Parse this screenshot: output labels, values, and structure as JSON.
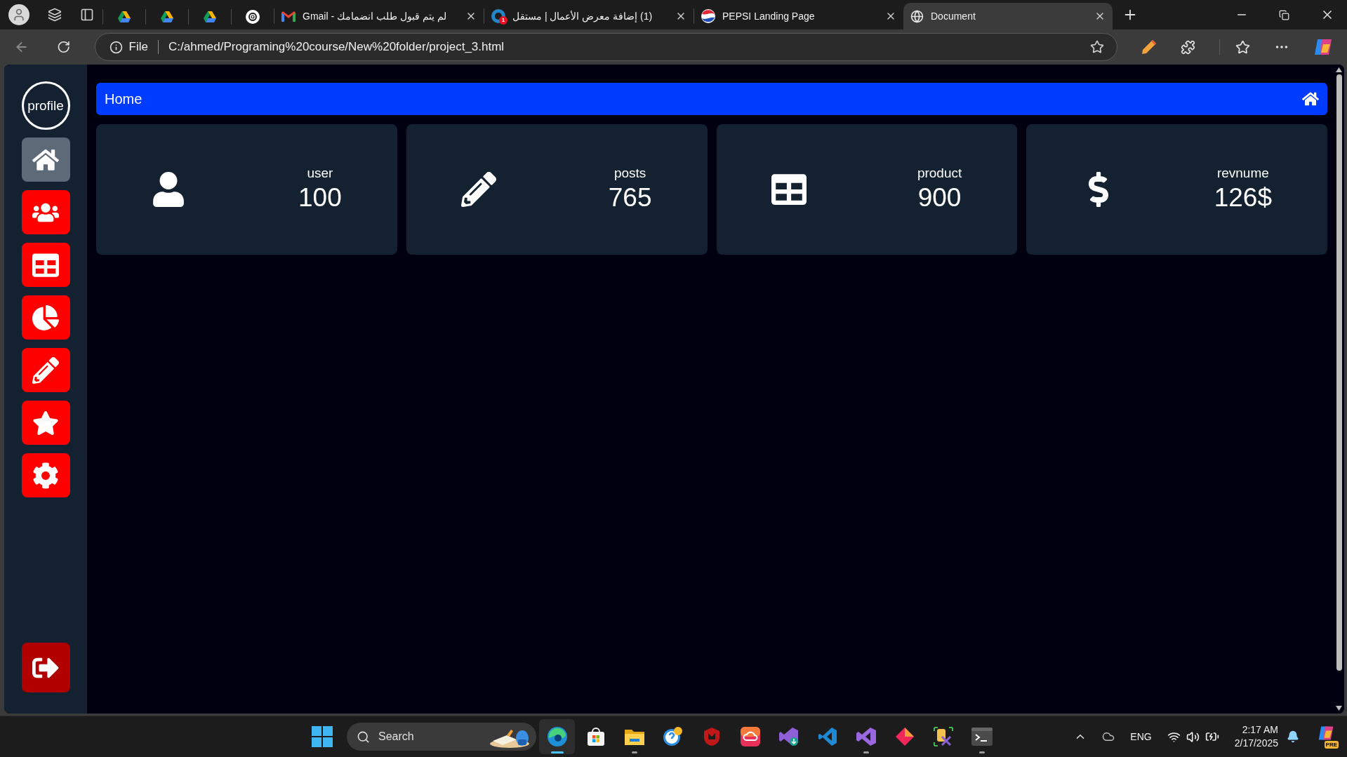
{
  "browser": {
    "tabs": [
      {
        "kind": "drive",
        "selected": false
      },
      {
        "kind": "drive",
        "selected": false
      },
      {
        "kind": "drive",
        "selected": false
      },
      {
        "kind": "chatgpt",
        "selected": false
      },
      {
        "kind": "gmail",
        "title": "لم يتم قبول طلب انضمامك - Gmail",
        "selected": false
      },
      {
        "kind": "mostaql",
        "title": "(1) إضافة معرض الأعمال | مستقل",
        "badge": "1",
        "selected": false
      },
      {
        "kind": "pepsi",
        "title": "PEPSI Landing Page",
        "selected": false
      },
      {
        "kind": "globe",
        "title": "Document",
        "selected": true
      }
    ],
    "address": {
      "scheme": "File",
      "url": "C:/ahmed/Programing%20course/New%20folder/project_3.html"
    }
  },
  "page": {
    "profile_alt": "profile",
    "sidebar": [
      {
        "kind": "home",
        "selected": true
      },
      {
        "kind": "users",
        "selected": false
      },
      {
        "kind": "table",
        "selected": false
      },
      {
        "kind": "chart",
        "selected": false
      },
      {
        "kind": "pen",
        "selected": false
      },
      {
        "kind": "star",
        "selected": false
      },
      {
        "kind": "gear",
        "selected": false
      }
    ],
    "logout": {
      "kind": "logout"
    },
    "header": {
      "title": "Home"
    },
    "cards": [
      {
        "kind": "user",
        "label": "user",
        "value": "100"
      },
      {
        "kind": "pen",
        "label": "posts",
        "value": "765"
      },
      {
        "kind": "table",
        "label": "product",
        "value": "900"
      },
      {
        "kind": "dollar",
        "label": "revnume",
        "value": "126$"
      }
    ]
  },
  "taskbar": {
    "search": {
      "placeholder": "Search"
    },
    "apps": [
      {
        "kind": "edge",
        "active": true,
        "open": true
      },
      {
        "kind": "store",
        "active": false,
        "open": false
      },
      {
        "kind": "folder",
        "active": false,
        "open": true
      },
      {
        "kind": "help",
        "active": false,
        "open": false
      },
      {
        "kind": "shield",
        "active": false,
        "open": false
      },
      {
        "kind": "cloud",
        "active": false,
        "open": false
      },
      {
        "kind": "vsinstaller",
        "active": false,
        "open": false
      },
      {
        "kind": "vscode",
        "active": false,
        "open": false
      },
      {
        "kind": "vs",
        "active": false,
        "open": true
      },
      {
        "kind": "diamond",
        "active": false,
        "open": false
      },
      {
        "kind": "tools",
        "active": false,
        "open": false
      },
      {
        "kind": "terminal",
        "active": false,
        "open": true
      }
    ],
    "language": "ENG",
    "time": "2:17 AM",
    "date": "2/17/2025",
    "copilot_badge": "PRE"
  }
}
